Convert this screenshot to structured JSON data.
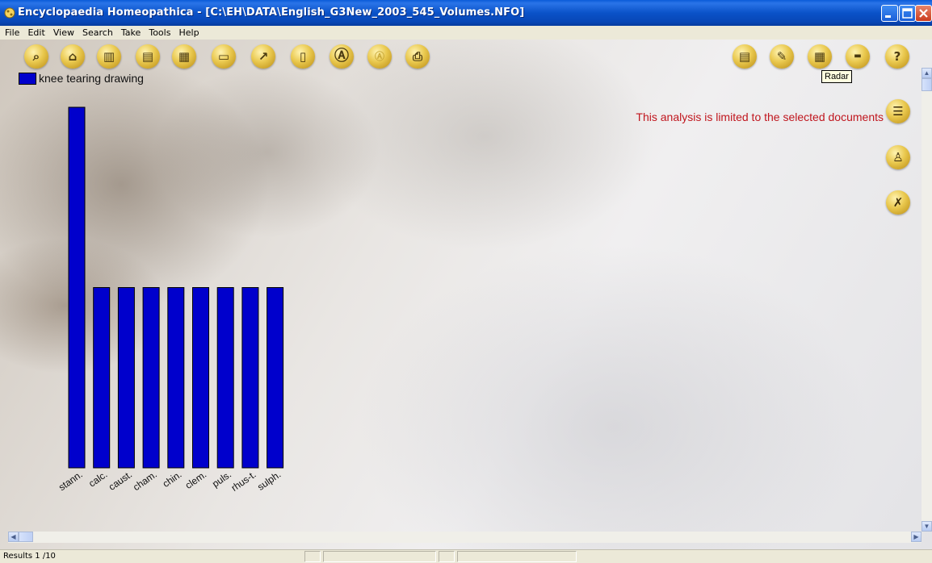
{
  "window": {
    "title": "Encyclopaedia Homeopathica - [C:\\EH\\DATA\\English_G3New_2003_545_Volumes.NFO]",
    "minimize_icon": "minimize-icon",
    "maximize_icon": "maximize-icon",
    "close_icon": "close-icon"
  },
  "menu": [
    {
      "label": "File"
    },
    {
      "label": "Edit"
    },
    {
      "label": "View"
    },
    {
      "label": "Search"
    },
    {
      "label": "Take"
    },
    {
      "label": "Tools"
    },
    {
      "label": "Help"
    }
  ],
  "toolbar": {
    "left_icons": [
      "search-icon",
      "home-icon",
      "book-columns-icon",
      "document-icon",
      "open-book-icon",
      "card-icon",
      "chart-icon",
      "letter-page-icon",
      "letter-a-large-icon",
      "letter-a-small-icon",
      "printer-icon"
    ],
    "right_icons": [
      "list-icon",
      "tree-icon",
      "radar-icon",
      "grid-icon",
      "help-icon"
    ],
    "tooltip": "Radar"
  },
  "notice": {
    "text": "This analysis is limited to the selected documents",
    "color": "#c0161e"
  },
  "side_buttons": [
    "documents-icon",
    "person-icon",
    "remove-icon"
  ],
  "chart_data": {
    "type": "bar",
    "legend": [
      {
        "name": "knee tearing drawing",
        "color": "#0000cc"
      }
    ],
    "categories": [
      "stann.",
      "calc.",
      "caust.",
      "cham.",
      "chin.",
      "clem.",
      "puls.",
      "rhus-t.",
      "sulph."
    ],
    "series": [
      {
        "name": "knee tearing drawing",
        "values": [
          2,
          1,
          1,
          1,
          1,
          1,
          1,
          1,
          1
        ]
      }
    ],
    "ylim": [
      0,
      2
    ],
    "grid": false,
    "bar_color": "#0000cc"
  },
  "status": {
    "results": "Results 1 /10"
  }
}
